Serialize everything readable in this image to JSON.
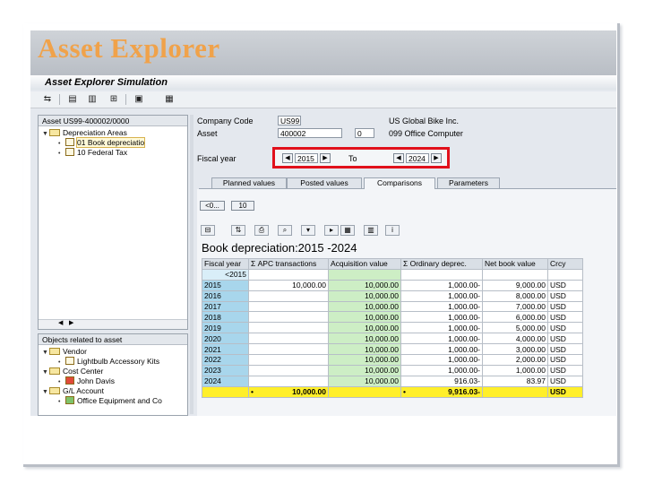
{
  "slide": {
    "title": "Asset Explorer"
  },
  "window": {
    "title": "Asset Explorer Simulation"
  },
  "toolbar": {
    "icons": [
      "switch-icon",
      "save-icon",
      "asset-value-icon",
      "depreciation-icon",
      "simulation-icon",
      "print-icon"
    ]
  },
  "left_tree": {
    "header": "Asset US99-400002/0000",
    "items": [
      {
        "label": "Depreciation Areas",
        "level": 0
      },
      {
        "label": "01 Book depreciatio",
        "level": 1,
        "selected": true
      },
      {
        "label": "10 Federal Tax",
        "level": 1
      }
    ]
  },
  "related_tree": {
    "header": "Objects related to asset",
    "items": [
      {
        "label": "Vendor",
        "level": 0
      },
      {
        "label": "Lightbulb Accessory Kits",
        "level": 1
      },
      {
        "label": "Cost Center",
        "level": 0
      },
      {
        "label": "John Davis",
        "level": 1
      },
      {
        "label": "G/L Account",
        "level": 0
      },
      {
        "label": "Office Equipment and Co",
        "level": 1
      }
    ]
  },
  "header_fields": {
    "company_code_label": "Company Code",
    "company_code_value": "US99",
    "company_code_desc": "US Global Bike Inc.",
    "asset_label": "Asset",
    "asset_value": "400002",
    "asset_sub": "0",
    "asset_desc": "099 Office Computer",
    "fiscal_year_label": "Fiscal year",
    "fiscal_year_from": "2015",
    "to_label": "To",
    "fiscal_year_to": "2024"
  },
  "tabs": [
    {
      "label": "Planned values",
      "active": false
    },
    {
      "label": "Posted values",
      "active": false
    },
    {
      "label": "Comparisons",
      "active": true
    },
    {
      "label": "Parameters",
      "active": false
    }
  ],
  "buttons": {
    "prev_label": "<0...",
    "next_label": "10"
  },
  "report": {
    "title": "Book depreciation:2015 -2024",
    "columns": [
      "Fiscal year",
      "Σ APC transactions",
      "Acquisition value",
      "Σ Ordinary deprec.",
      "Net book value",
      "Crcy"
    ],
    "rows": [
      [
        "<2015",
        "",
        "",
        "",
        "",
        ""
      ],
      [
        "2015",
        "10,000.00",
        "10,000.00",
        "1,000.00-",
        "9,000.00",
        "USD"
      ],
      [
        "2016",
        "",
        "10,000.00",
        "1,000.00-",
        "8,000.00",
        "USD"
      ],
      [
        "2017",
        "",
        "10,000.00",
        "1,000.00-",
        "7,000.00",
        "USD"
      ],
      [
        "2018",
        "",
        "10,000.00",
        "1,000.00-",
        "6,000.00",
        "USD"
      ],
      [
        "2019",
        "",
        "10,000.00",
        "1,000.00-",
        "5,000.00",
        "USD"
      ],
      [
        "2020",
        "",
        "10,000.00",
        "1,000.00-",
        "4,000.00",
        "USD"
      ],
      [
        "2021",
        "",
        "10,000.00",
        "1,000.00-",
        "3,000.00",
        "USD"
      ],
      [
        "2022",
        "",
        "10,000.00",
        "1,000.00-",
        "2,000.00",
        "USD"
      ],
      [
        "2023",
        "",
        "10,000.00",
        "1,000.00-",
        "1,000.00",
        "USD"
      ],
      [
        "2024",
        "",
        "10,000.00",
        "916.03-",
        "83.97",
        "USD"
      ]
    ],
    "total": [
      "",
      "10,000.00",
      "",
      "9,916.03-",
      "",
      "USD"
    ],
    "total_marks": [
      "",
      "•",
      "",
      "•",
      "",
      ""
    ]
  }
}
